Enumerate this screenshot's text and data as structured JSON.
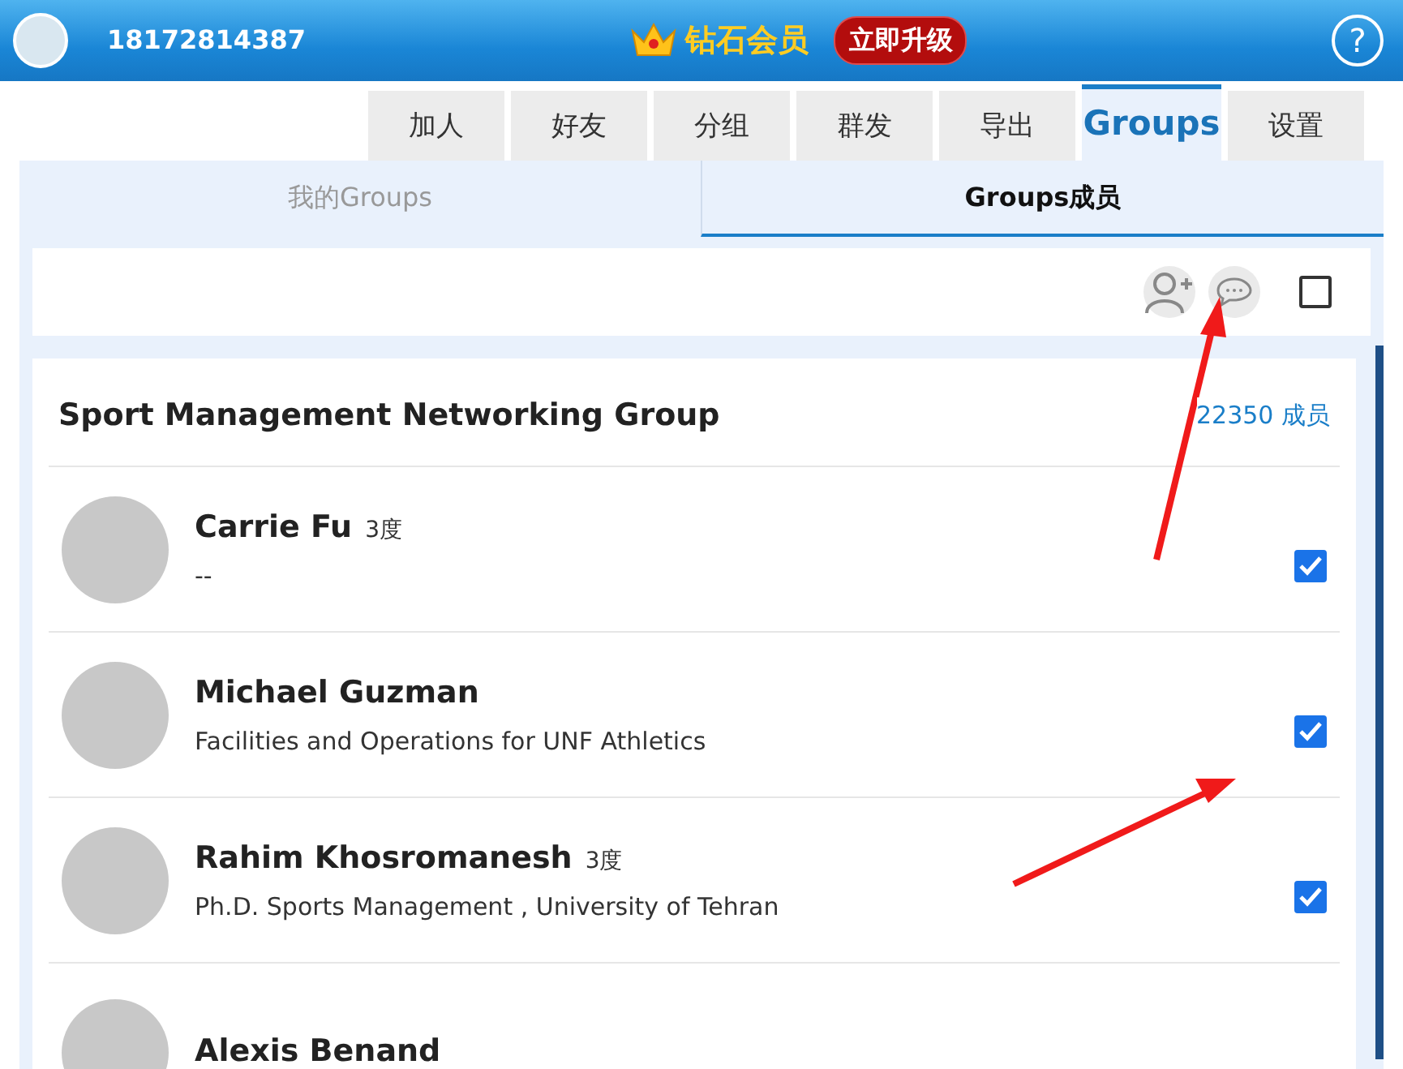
{
  "header": {
    "phone": "18172814387",
    "membership": "钻石会员",
    "upgrade_button": "立即升级",
    "help": "?"
  },
  "tabs": [
    {
      "label": "加人",
      "selected": false
    },
    {
      "label": "好友",
      "selected": false
    },
    {
      "label": "分组",
      "selected": false
    },
    {
      "label": "群发",
      "selected": false
    },
    {
      "label": "导出",
      "selected": false
    },
    {
      "label": "Groups",
      "selected": true
    },
    {
      "label": "设置",
      "selected": false
    }
  ],
  "subtabs": [
    {
      "label": "我的Groups",
      "selected": false
    },
    {
      "label": "Groups成员",
      "selected": true
    }
  ],
  "toolbar": {
    "select_all_checked": false
  },
  "group": {
    "name": "Sport Management Networking Group",
    "member_count": "22350 成员"
  },
  "members": [
    {
      "name": "Carrie Fu",
      "degree": "3度",
      "headline": "--",
      "checked": true
    },
    {
      "name": "Michael Guzman",
      "headline": "Facilities and Operations for UNF Athletics",
      "checked": true
    },
    {
      "name": "Rahim Khosromanesh",
      "degree": "3度",
      "headline": "Ph.D. Sports Management , University of Tehran",
      "checked": true
    },
    {
      "name": "Alexis Benand"
    }
  ]
}
